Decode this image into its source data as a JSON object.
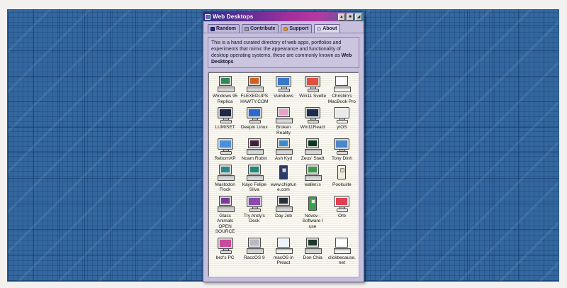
{
  "window": {
    "title": "Web Desktops",
    "controls": [
      {
        "name": "shade",
        "glyph": "▲"
      },
      {
        "name": "maximize",
        "glyph": "■"
      },
      {
        "name": "close",
        "glyph": "◢"
      }
    ],
    "tabs": [
      {
        "label": "Random",
        "icon": "dice-icon",
        "icon_color": "#2a2a7c",
        "round": false,
        "active": false
      },
      {
        "label": "Contribute",
        "icon": "pencil-icon",
        "icon_color": "#9a9aa8",
        "round": false,
        "active": false
      },
      {
        "label": "Support",
        "icon": "heart-icon",
        "icon_color": "#e89a28",
        "round": true,
        "active": false
      },
      {
        "label": "About",
        "icon": "info-icon",
        "icon_color": "#c9d5e8",
        "round": true,
        "active": true
      }
    ],
    "description": {
      "text": "This is a hand curated directory of web apps, portfolios and experiments that mimic the appearance and functionality of desktop operating systems, these are commonly known as ",
      "bold": "Web Desktops"
    },
    "items": [
      {
        "label": "Windows 95 Replica",
        "icon": "laptop",
        "screen": "#2e8b57"
      },
      {
        "label": "FLEXEDUPSHAWTY.COM",
        "icon": "laptop",
        "screen": "#d06020"
      },
      {
        "label": "Vuindows",
        "icon": "monitor",
        "screen": "#3a78c8"
      },
      {
        "label": "Win11 Svelte",
        "icon": "monitor",
        "screen": "#e05040"
      },
      {
        "label": "Chrisbin's MacBook Pro",
        "icon": "laptop",
        "screen": "#fbfbfb",
        "body": "#f4f4f4"
      },
      {
        "label": "LUMISET",
        "icon": "monitor",
        "screen": "#202848"
      },
      {
        "label": "Deepin Linux",
        "icon": "monitor",
        "screen": "#2a6ad0"
      },
      {
        "label": "Broken Reality",
        "icon": "laptop",
        "screen": "#e8a0c8"
      },
      {
        "label": "Win11React",
        "icon": "monitor",
        "screen": "#1c2c50"
      },
      {
        "label": "ytOS",
        "icon": "monitor",
        "screen": "#e9e9e9",
        "body": "#f0f0f0"
      },
      {
        "label": "RebornXP",
        "icon": "monitor",
        "screen": "#4a90d8"
      },
      {
        "label": "Noam Rubin",
        "icon": "laptop",
        "screen": "#40203a"
      },
      {
        "label": "Ash Kyd",
        "icon": "laptop",
        "screen": "#3a8ad0"
      },
      {
        "label": "Zeus' Stadt",
        "icon": "laptop",
        "screen": "#0c3a1c"
      },
      {
        "label": "Tony Dinh",
        "icon": "monitor",
        "screen": "#4a88c8"
      },
      {
        "label": "Mastodon Flock",
        "icon": "laptop",
        "screen": "#2a8a8a"
      },
      {
        "label": "Kayo Felipe Silva",
        "icon": "laptop",
        "screen": "#1a8a7a"
      },
      {
        "label": "www.chiptune.com",
        "icon": "tower",
        "screen": "#2a3a6a"
      },
      {
        "label": "waller.is",
        "icon": "laptop",
        "screen": "#3a9a4a"
      },
      {
        "label": "Poolsuite",
        "icon": "tower",
        "screen": "#efece2",
        "body": "#d8d5c8"
      },
      {
        "label": "Glass Animals OPEN SOURCE",
        "icon": "laptop",
        "screen": "#7a3a9a"
      },
      {
        "label": "Try Andy's Desk",
        "icon": "monitor",
        "screen": "#8a4ab0"
      },
      {
        "label": "Day Job",
        "icon": "laptop",
        "screen": "#283038"
      },
      {
        "label": "Novov - Software I use",
        "icon": "tower",
        "screen": "#3aa04a",
        "body": "#e8e8e8"
      },
      {
        "label": "Orb",
        "icon": "monitor",
        "screen": "#e04050",
        "body": "#f0f0f0"
      },
      {
        "label": "bez's PC",
        "icon": "monitor",
        "screen": "#c84a9a"
      },
      {
        "label": "RaccOS 9",
        "icon": "laptop",
        "screen": "#b8b8c4"
      },
      {
        "label": "macOS in Preact",
        "icon": "laptop",
        "screen": "#eaf2fc",
        "body": "#f4f4f4"
      },
      {
        "label": "Don Chia",
        "icon": "laptop",
        "screen": "#1a3a2a"
      },
      {
        "label": "clickbecause.net",
        "icon": "laptop",
        "screen": "#ffffff",
        "body": "#f4f4f4"
      }
    ]
  },
  "colors": {
    "page_blue": "#34679e",
    "window_bg": "#c7c0dc",
    "titlebar_gradient": [
      "#2f2f86",
      "#a5309c",
      "#3f86a6"
    ],
    "panel_bg": "#faf8f1"
  }
}
